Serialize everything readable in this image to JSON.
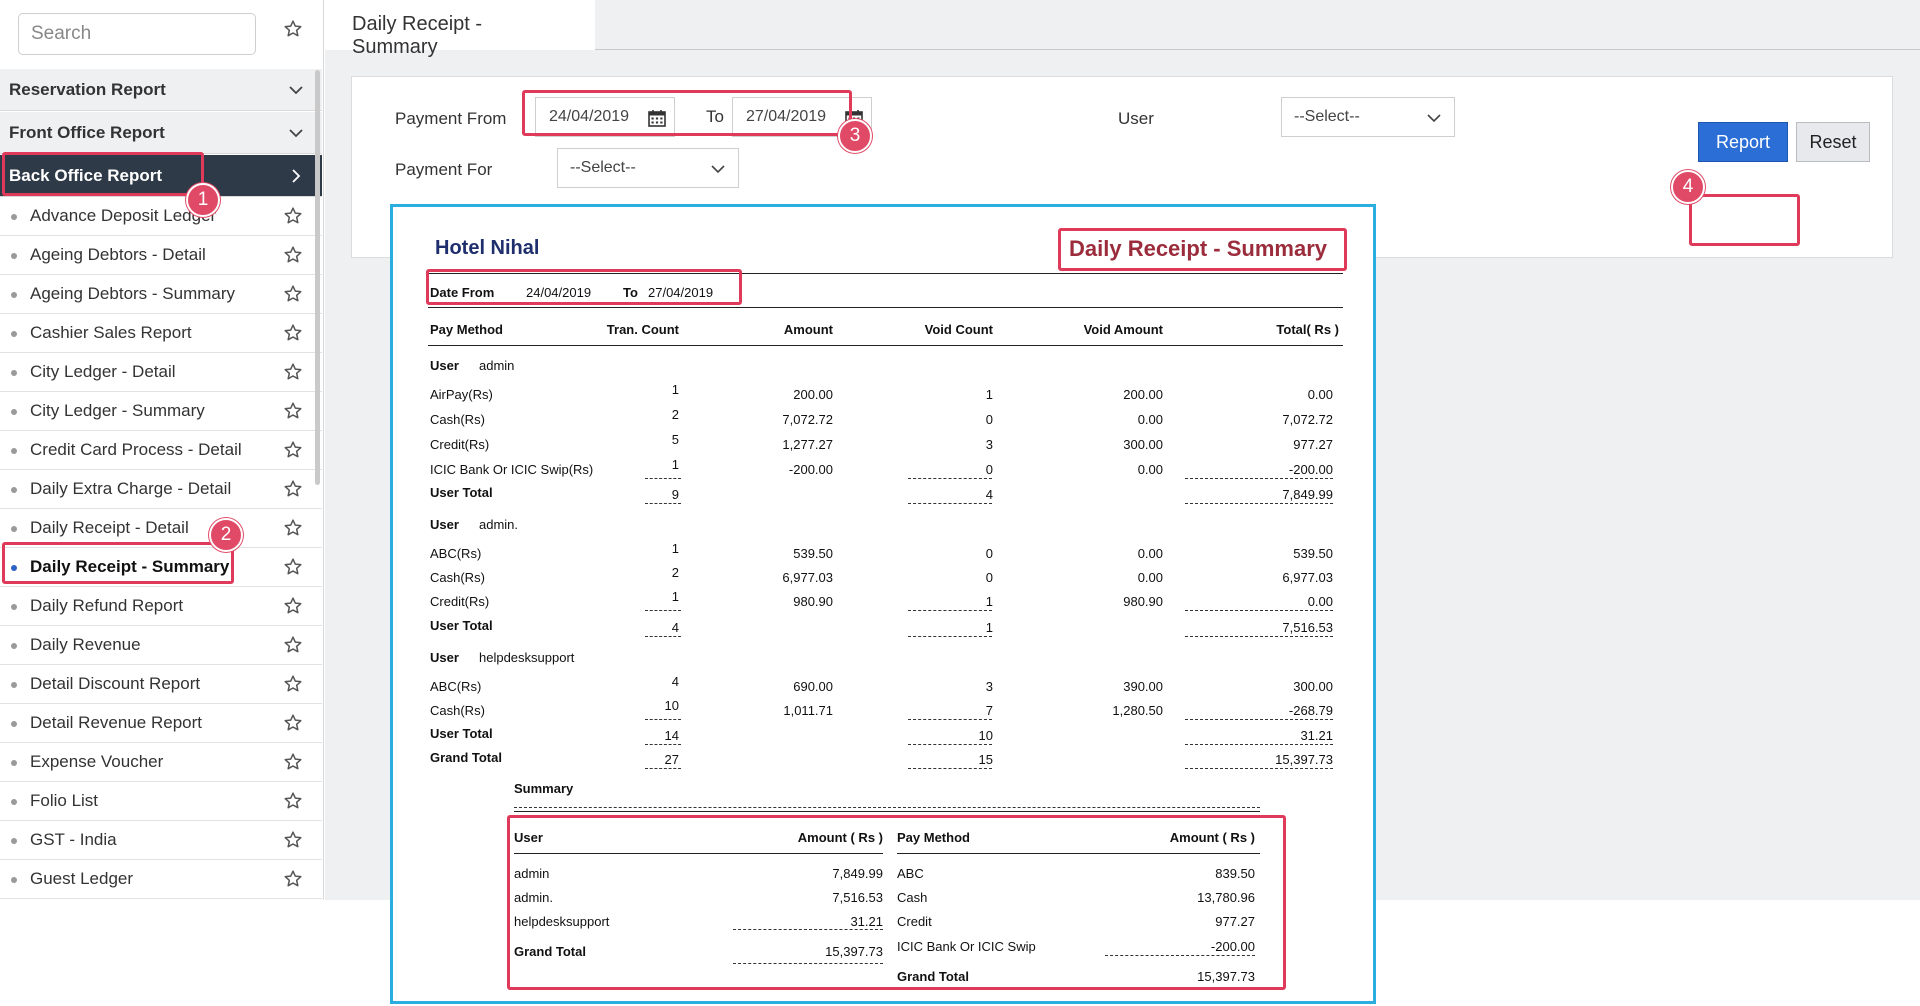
{
  "sidebar": {
    "search_placeholder": "Search",
    "categories": [
      {
        "label": "Reservation Report"
      },
      {
        "label": "Front Office Report"
      },
      {
        "label": "Back Office Report"
      }
    ],
    "items": [
      {
        "label": "Advance Deposit Ledger"
      },
      {
        "label": "Ageing Debtors - Detail"
      },
      {
        "label": "Ageing Debtors - Summary"
      },
      {
        "label": "Cashier Sales Report"
      },
      {
        "label": "City Ledger - Detail"
      },
      {
        "label": "City Ledger - Summary"
      },
      {
        "label": "Credit Card Process - Detail"
      },
      {
        "label": "Daily Extra Charge - Detail"
      },
      {
        "label": "Daily Receipt - Detail"
      },
      {
        "label": "Daily Receipt - Summary"
      },
      {
        "label": "Daily Refund Report"
      },
      {
        "label": "Daily Revenue"
      },
      {
        "label": "Detail Discount Report"
      },
      {
        "label": "Detail Revenue Report"
      },
      {
        "label": "Expense Voucher"
      },
      {
        "label": "Folio List"
      },
      {
        "label": "GST - India"
      },
      {
        "label": "Guest Ledger"
      }
    ]
  },
  "main": {
    "tab_title": "Daily Receipt - Summary",
    "filters": {
      "payment_from_label": "Payment From",
      "from_date": "24/04/2019",
      "to_label": "To",
      "to_date": "27/04/2019",
      "user_label": "User",
      "user_select": "--Select--",
      "payment_for_label": "Payment For",
      "payment_for_select": "--Select--"
    },
    "buttons": {
      "report": "Report",
      "reset": "Reset"
    }
  },
  "annotations": [
    "1",
    "2",
    "3",
    "4"
  ],
  "report": {
    "hotel": "Hotel Nihal",
    "title": "Daily Receipt - Summary",
    "date_from_label": "Date From",
    "date_from": "24/04/2019",
    "to_label": "To",
    "date_to": "27/04/2019",
    "columns": [
      "Pay Method",
      "Tran. Count",
      "Amount",
      "Void Count",
      "Void Amount",
      "Total( Rs )"
    ],
    "user_label": "User",
    "user_total_label": "User Total",
    "grand_total_label": "Grand Total",
    "groups": [
      {
        "user": "admin",
        "rows": [
          [
            "AirPay(Rs)",
            "1",
            "200.00",
            "1",
            "200.00",
            "0.00"
          ],
          [
            "Cash(Rs)",
            "2",
            "7,072.72",
            "0",
            "0.00",
            "7,072.72"
          ],
          [
            "Credit(Rs)",
            "5",
            "1,277.27",
            "3",
            "300.00",
            "977.27"
          ],
          [
            "ICIC Bank Or ICIC Swip(Rs)",
            "1",
            "-200.00",
            "0",
            "0.00",
            "-200.00"
          ]
        ],
        "total": [
          "9",
          "4",
          "7,849.99"
        ]
      },
      {
        "user": "admin.",
        "rows": [
          [
            "ABC(Rs)",
            "1",
            "539.50",
            "0",
            "0.00",
            "539.50"
          ],
          [
            "Cash(Rs)",
            "2",
            "6,977.03",
            "0",
            "0.00",
            "6,977.03"
          ],
          [
            "Credit(Rs)",
            "1",
            "980.90",
            "1",
            "980.90",
            "0.00"
          ]
        ],
        "total": [
          "4",
          "1",
          "7,516.53"
        ]
      },
      {
        "user": "helpdesksupport",
        "rows": [
          [
            "ABC(Rs)",
            "4",
            "690.00",
            "3",
            "390.00",
            "300.00"
          ],
          [
            "Cash(Rs)",
            "10",
            "1,011.71",
            "7",
            "1,280.50",
            "-268.79"
          ]
        ],
        "total": [
          "14",
          "10",
          "31.21"
        ]
      }
    ],
    "grand_total": [
      "27",
      "15",
      "15,397.73"
    ],
    "summary": {
      "title": "Summary",
      "user_header": "User",
      "amount_header": "Amount ( Rs )",
      "paymethod_header": "Pay Method",
      "users": [
        [
          "admin",
          "7,849.99"
        ],
        [
          "admin.",
          "7,516.53"
        ],
        [
          "helpdesksupport",
          "31.21"
        ]
      ],
      "user_grand_total": "15,397.73",
      "methods": [
        [
          "ABC",
          "839.50"
        ],
        [
          "Cash",
          "13,780.96"
        ],
        [
          "Credit",
          "977.27"
        ],
        [
          "ICIC Bank Or ICIC Swip",
          "-200.00"
        ]
      ],
      "method_grand_total": "15,397.73"
    }
  }
}
